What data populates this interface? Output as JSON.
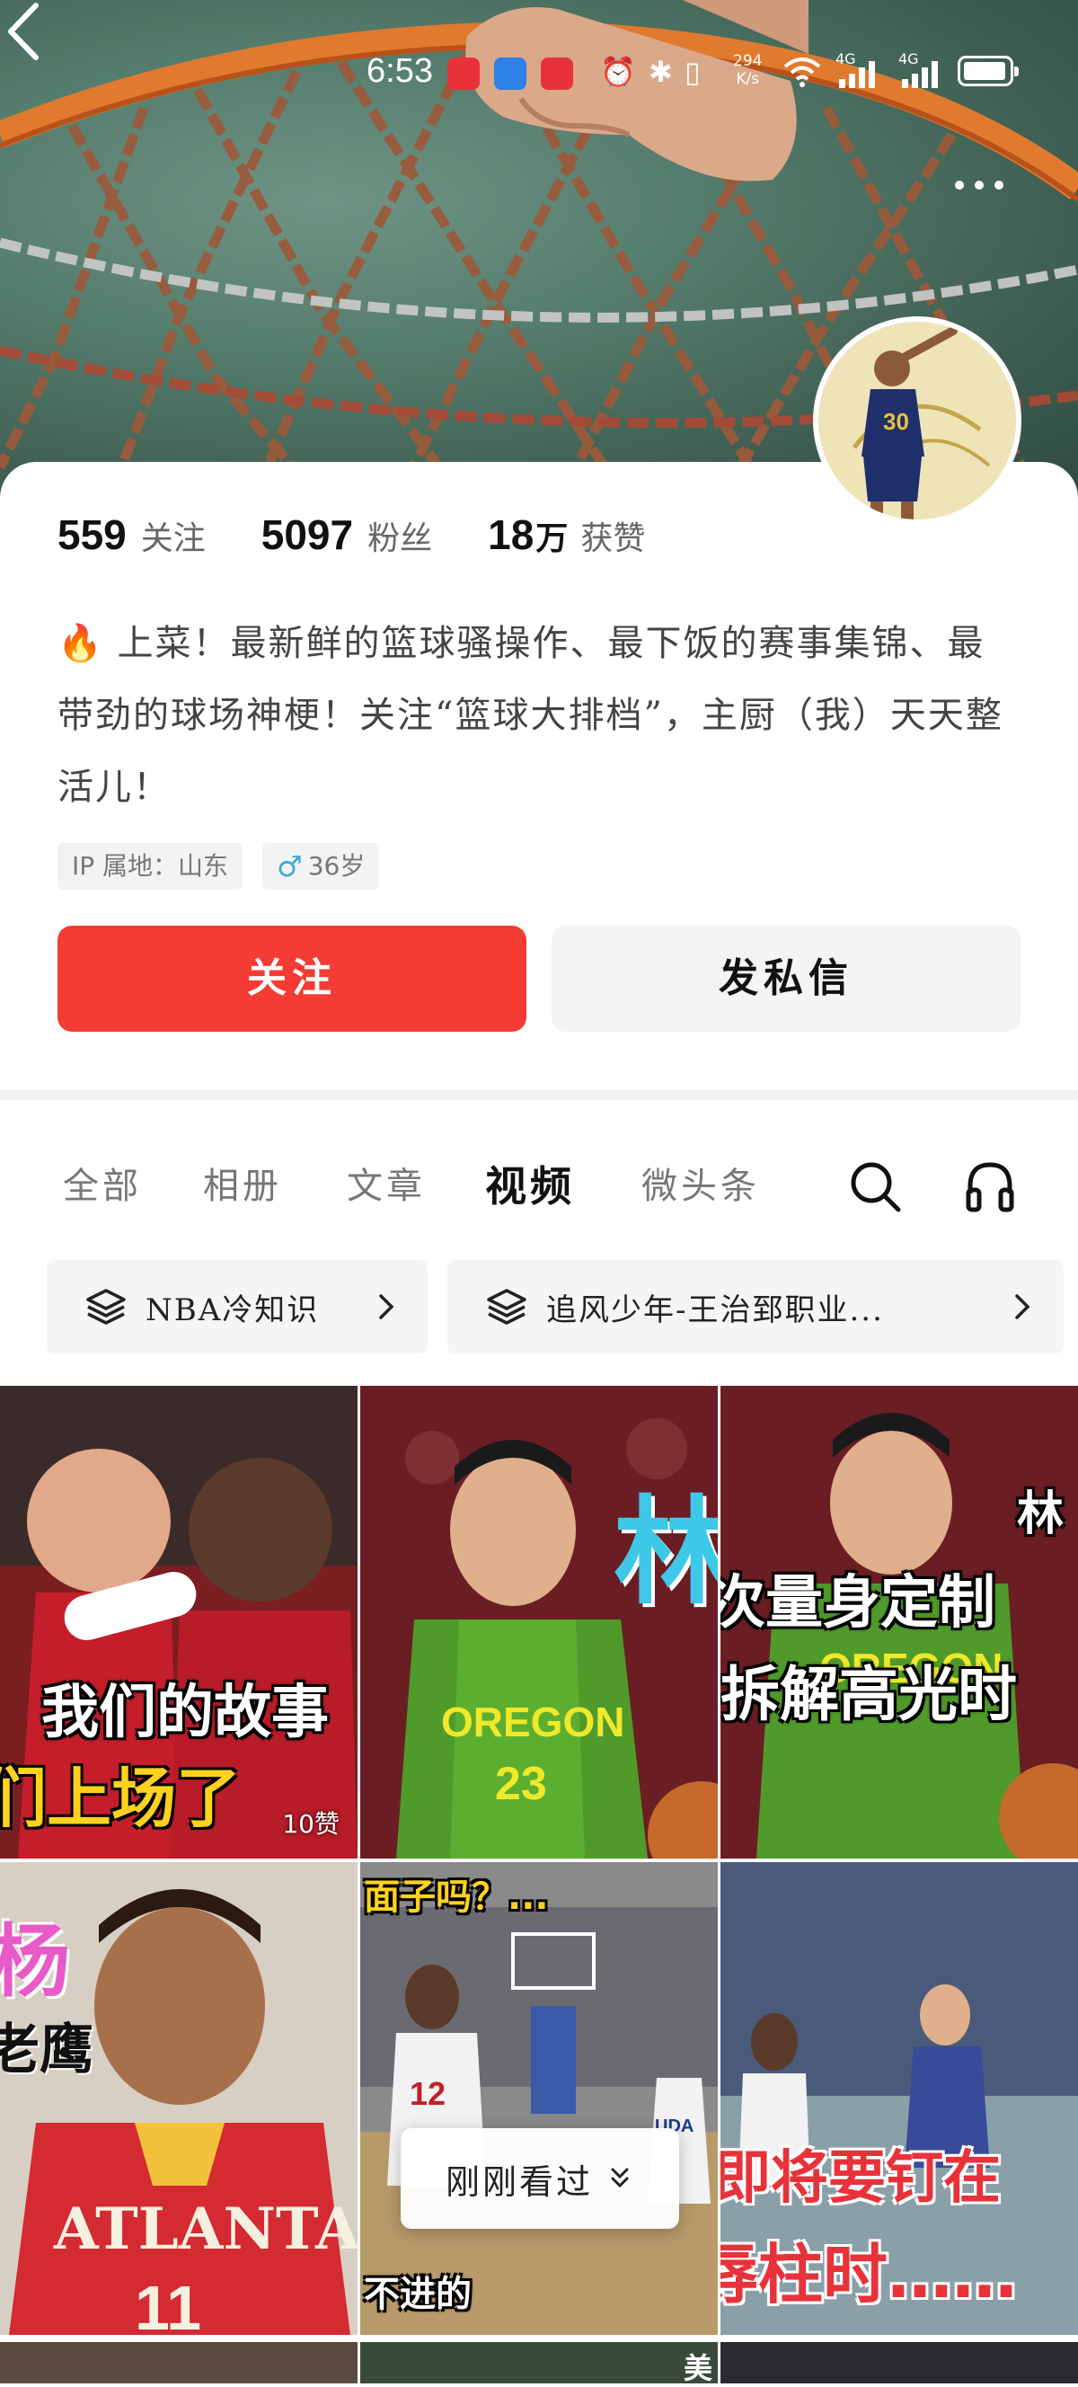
{
  "status_bar": {
    "time": "6:53",
    "network_speed": "294",
    "network_speed_unit": "K/s",
    "signal_1": "4G",
    "signal_2": "4G"
  },
  "profile": {
    "stats": [
      {
        "num": "559",
        "unit": "",
        "label": "关注"
      },
      {
        "num": "5097",
        "unit": "",
        "label": "粉丝"
      },
      {
        "num": "18",
        "unit": "万",
        "label": "获赞"
      }
    ],
    "bio_emoji": "🔥",
    "bio": "上菜！最新鲜的篮球骚操作、最下饭的赛事集锦、最带劲的球场神梗！关注“篮球大排档”，主厨（我）天天整活儿！",
    "tags": {
      "ip": "IP 属地：山东",
      "age": "36岁",
      "gender_symbol": "♂"
    },
    "follow_label": "关注",
    "message_label": "发私信"
  },
  "tabs": [
    {
      "label": "全部",
      "active": false
    },
    {
      "label": "相册",
      "active": false
    },
    {
      "label": "文章",
      "active": false
    },
    {
      "label": "视频",
      "active": true
    },
    {
      "label": "微头条",
      "active": false
    }
  ],
  "collections": [
    {
      "title": "NBA冷知识"
    },
    {
      "title": "追风少年-王治郅职业..."
    }
  ],
  "videos": [
    {
      "caption_1": "我们的故事",
      "caption_2": "们上场了",
      "likes": "10赞"
    },
    {
      "caption_1": "林",
      "caption_2": ""
    },
    {
      "caption_1": "林",
      "caption_2": "次量身定制",
      "caption_3": "拆解高光时"
    },
    {
      "caption_1": "杨",
      "caption_2": "老鹰",
      "jersey": "ATLANTA",
      "jersey_num": "11"
    },
    {
      "caption_1": "面子吗？...",
      "caption_2": "不进的",
      "score_banner": "UDA"
    },
    {
      "caption_1": "即将要钉在",
      "caption_2": "辱柱时……"
    }
  ],
  "recently_viewed_label": "刚刚看过",
  "bottom_row_fragment": "美",
  "colors": {
    "accent": "#f43c34",
    "active_tab": "#111111",
    "inactive_tab": "#777777"
  }
}
